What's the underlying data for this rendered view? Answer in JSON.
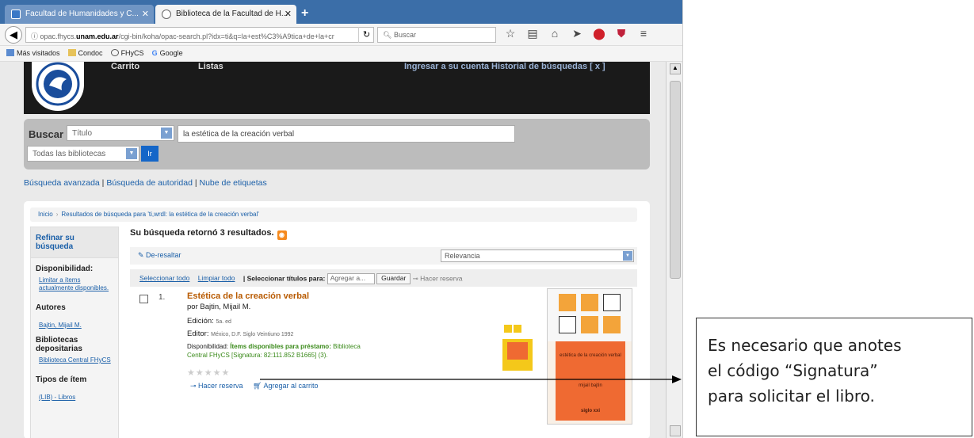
{
  "browser": {
    "tabs": [
      {
        "label": "Facultad de Humanidades y C...",
        "active": false
      },
      {
        "label": "Biblioteca de la Facultad de H...",
        "active": true
      }
    ],
    "url_prefix": "opac.fhycs.",
    "url_domain": "unam.edu.ar",
    "url_rest": "/cgi-bin/koha/opac-search.pl?idx=ti&q=la+est%C3%A9tica+de+la+cr",
    "search_placeholder": "Buscar",
    "bookmarks": [
      "Más visitados",
      "Condoc",
      "FHyCS",
      "Google"
    ]
  },
  "header": {
    "logo_alt": "FHyCS",
    "link1": "Carrito",
    "link2": "Listas",
    "user_links": "Ingresar a su cuenta   Historial de búsquedas [ x ]"
  },
  "search": {
    "label": "Buscar",
    "field": "Título",
    "query": "la estética de la creación verbal",
    "library": "Todas las bibliotecas",
    "go": "Ir",
    "links": [
      "Búsqueda avanzada",
      "Búsqueda de autoridad",
      "Nube de etiquetas"
    ]
  },
  "breadcrumb": [
    "Inicio",
    "Resultados de búsqueda para 'ti,wrdl: la estética de la creación verbal'"
  ],
  "facets": {
    "title": "Refinar su búsqueda",
    "availability_heading": "Disponibilidad:",
    "availability_link": "Limitar a ítems actualmente disponibles.",
    "authors_heading": "Autores",
    "author_link": "Bajtin, Mijail M.",
    "libraries_heading": "Bibliotecas depositarias",
    "library_link": "Biblioteca Central FHyCS",
    "itemtype_heading": "Tipos de ítem",
    "itemtype_link": "(LIB) - Libros"
  },
  "results": {
    "heading": "Su búsqueda retornó 3 resultados.",
    "unhighlight": "De-resaltar",
    "sort": "Relevancia",
    "select_all": "Seleccionar todo",
    "clear_all": "Limpiar todo",
    "select_titles_for": "Seleccionar títulos para:",
    "add_to": "Agregar a...",
    "save": "Guardar",
    "place_hold": "Hacer reserva",
    "item": {
      "number": "1.",
      "title": "Estética de la creación verbal",
      "author": "por Bajtin, Mijail M.",
      "edition_label": "Edición:",
      "edition": "5a. ed",
      "publisher_label": "Editor:",
      "publisher": "México, D.F. Siglo Veintiuno 1992",
      "availability_label": "Disponibilidad:",
      "availability_items": "Ítems disponibles para préstamo:",
      "availability_detail": "Biblioteca Central FHyCS [Signatura: 82:111.852 B1665] (3).",
      "hold": "Hacer reserva",
      "cart": "Agregar al carrito",
      "cover_title": "estética de la creación verbal",
      "cover_author": "mijail bajtin",
      "cover_publisher": "siglo xxi"
    }
  },
  "annotation": {
    "line1": "Es necesario que anotes",
    "line2": "el código “Signatura”",
    "line3": "para solicitar el libro."
  }
}
